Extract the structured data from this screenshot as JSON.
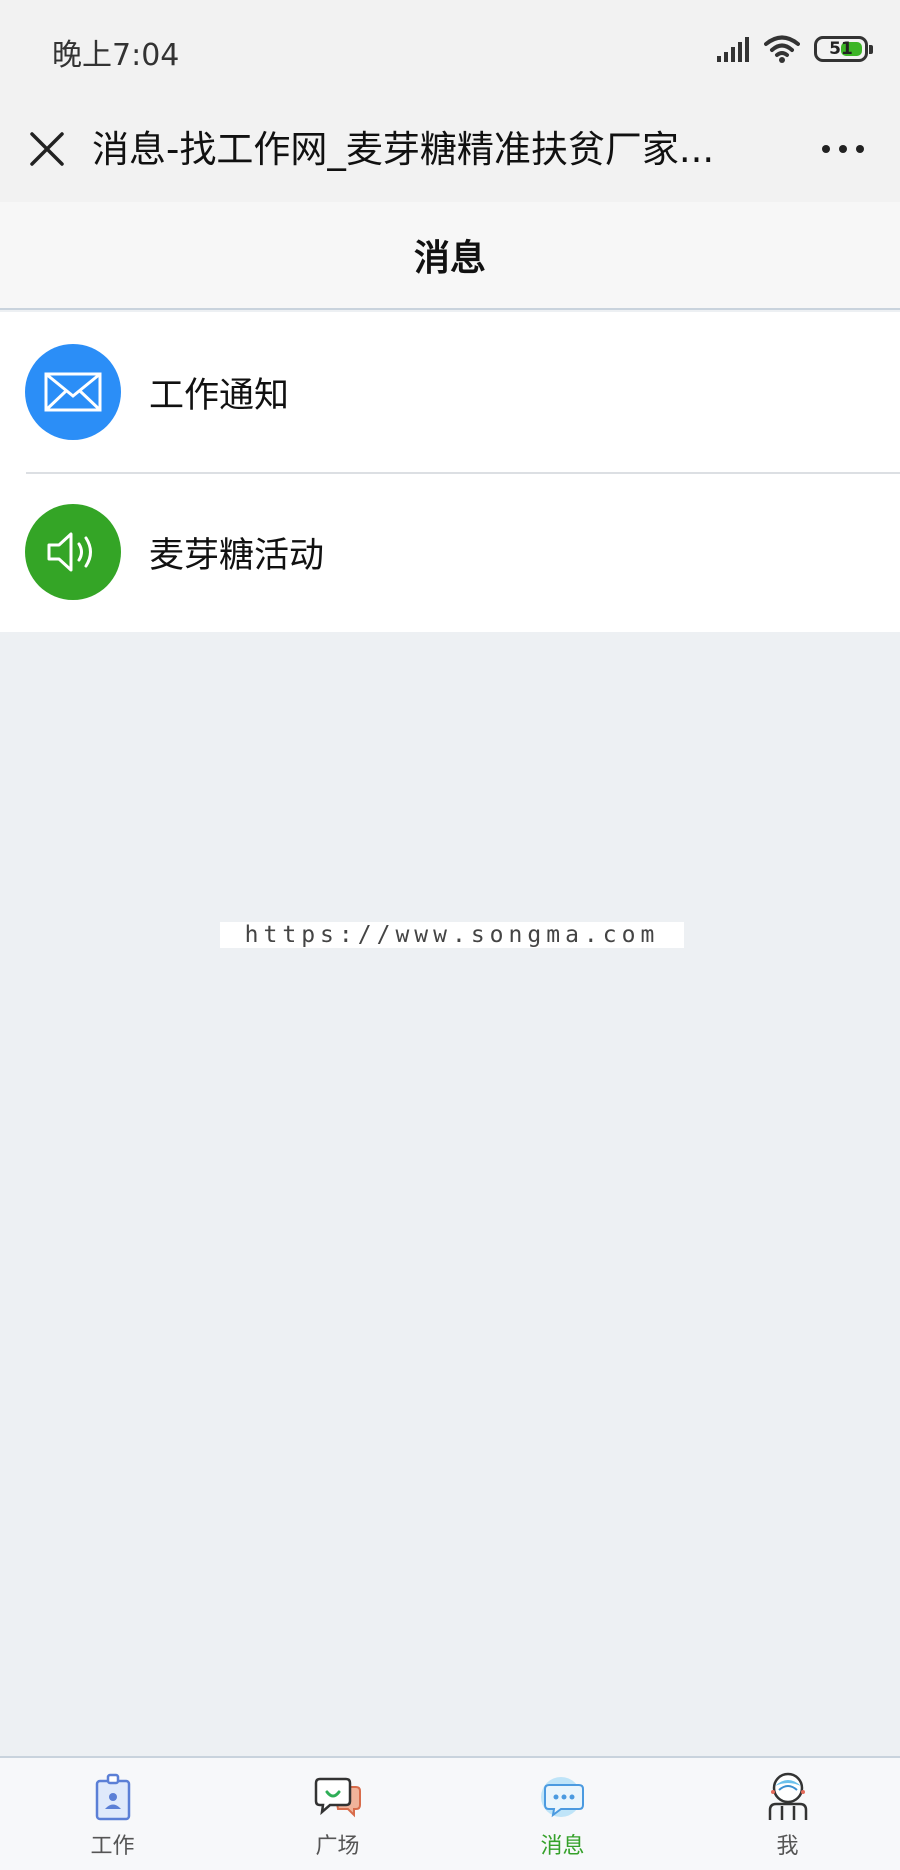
{
  "status_bar": {
    "time": "晚上7:04",
    "battery_level": "51",
    "battery_percent": 51,
    "icons": [
      "signal-icon",
      "wifi-icon",
      "battery-icon"
    ]
  },
  "title_bar": {
    "title": "消息-找工作网_麦芽糖精准扶贫厂家...",
    "close_icon": "close-icon",
    "more_icon": "more-icon"
  },
  "header": {
    "title": "消息"
  },
  "messages": [
    {
      "label": "工作通知",
      "icon": "envelope-icon",
      "color": "#2b8ef7"
    },
    {
      "label": "麦芽糖活动",
      "icon": "speaker-icon",
      "color": "#34a526"
    }
  ],
  "watermark": "https://www.songma.com",
  "tabs": [
    {
      "label": "工作",
      "icon": "badge-icon",
      "active": false
    },
    {
      "label": "广场",
      "icon": "chat-bubbles-icon",
      "active": false
    },
    {
      "label": "消息",
      "icon": "message-icon",
      "active": true
    },
    {
      "label": "我",
      "icon": "person-icon",
      "active": false
    }
  ],
  "colors": {
    "accent_green": "#35a12a",
    "blue": "#2b8ef7",
    "background": "#edf0f3"
  }
}
